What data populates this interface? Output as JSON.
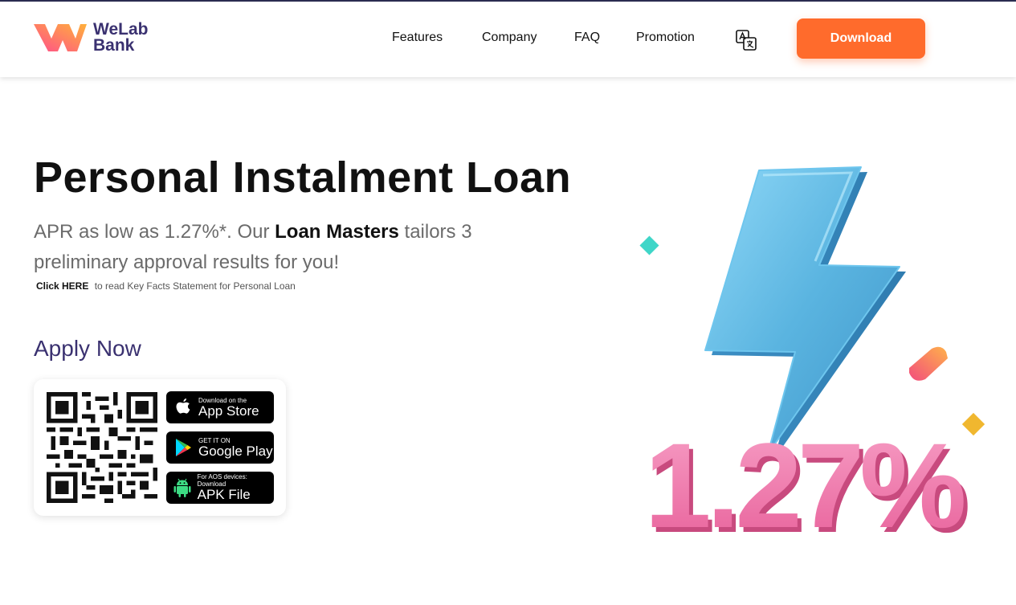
{
  "header": {
    "logo_line1": "WeLab",
    "logo_line2": "Bank",
    "nav": [
      "Features",
      "Company",
      "FAQ",
      "Promotion"
    ],
    "language_icon": "translate-icon",
    "download_label": "Download"
  },
  "hero": {
    "title": "Personal Instalment Loan",
    "subtitle_pre": "APR as low as 1.27%*. Our ",
    "subtitle_bold": "Loan Masters",
    "subtitle_post": " tailors 3 preliminary approval results for you!",
    "kfs_link": "Click HERE",
    "kfs_text": "to read Key Facts Statement for Personal Loan",
    "apply_title": "Apply Now",
    "rate_graphic": "1.27%"
  },
  "stores": [
    {
      "small": "Download on the",
      "big": "App Store",
      "icon": "apple-icon"
    },
    {
      "small": "GET IT ON",
      "big": "Google Play",
      "icon": "google-play-icon"
    },
    {
      "small": "For AOS devices: Download",
      "big": "APK File",
      "icon": "android-icon"
    }
  ],
  "colors": {
    "brand_purple": "#3a3170",
    "download_orange": "#ff6b2c",
    "bolt_blue": "#5ab4e0",
    "rate_pink": "#ec6fa3"
  }
}
